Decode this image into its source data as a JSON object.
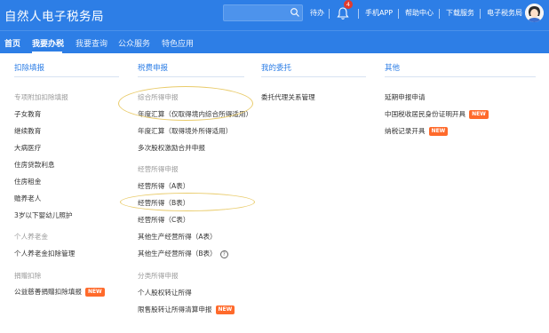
{
  "header": {
    "title": "自然人电子税务局",
    "search_placeholder": "",
    "todo_label": "待办",
    "notification_count": "4",
    "links": [
      "手机APP",
      "帮助中心",
      "下载服务",
      "电子税务局"
    ]
  },
  "nav": {
    "items": [
      "首页",
      "我要办税",
      "我要查询",
      "公众服务",
      "特色应用"
    ],
    "active_index": 1
  },
  "columns": {
    "deduction": {
      "header": "扣除填报",
      "groups": [
        {
          "title": "专项附加扣除填报",
          "items": [
            "子女教育",
            "继续教育",
            "大病医疗",
            "住房贷款利息",
            "住房租金",
            "赡养老人",
            "3岁以下婴幼儿照护"
          ]
        },
        {
          "title": "个人养老金",
          "items": [
            "个人养老金扣除管理"
          ]
        },
        {
          "title": "捐赠扣除",
          "items": [
            "公益慈善捐赠扣除填报"
          ]
        }
      ],
      "new_badge": "NEW"
    },
    "declare": {
      "header": "税费申报",
      "group1_title": "综合所得申报",
      "group1_items": [
        "年度汇算（仅取得境内综合所得适用）",
        "年度汇算（取得境外所得适用）",
        "多次股权激励合并申报"
      ],
      "group2_title": "经营所得申报",
      "group2_items": [
        "经营所得（A表）",
        "经营所得（B表）",
        "经营所得（C表）",
        "其他生产经营所得（A表）",
        "其他生产经营所得（B表）"
      ],
      "help_glyph": "?",
      "group3_title": "分类所得申报",
      "group3_items": [
        "个人股权转让所得",
        "限售股转让所得清算申报"
      ],
      "new_badge": "NEW"
    },
    "delegation": {
      "header": "我的委托",
      "items": [
        "委托代理关系管理"
      ]
    },
    "other": {
      "header": "其他",
      "items": [
        "延期申报申请",
        "中国税收居民身份证明开具",
        "纳税记录开具"
      ],
      "new_badge": "NEW"
    }
  },
  "colors": {
    "brand_blue": "#2d7ee6",
    "new_badge": "#ff6a2b",
    "highlight_ellipse": "#e9cb6a"
  }
}
